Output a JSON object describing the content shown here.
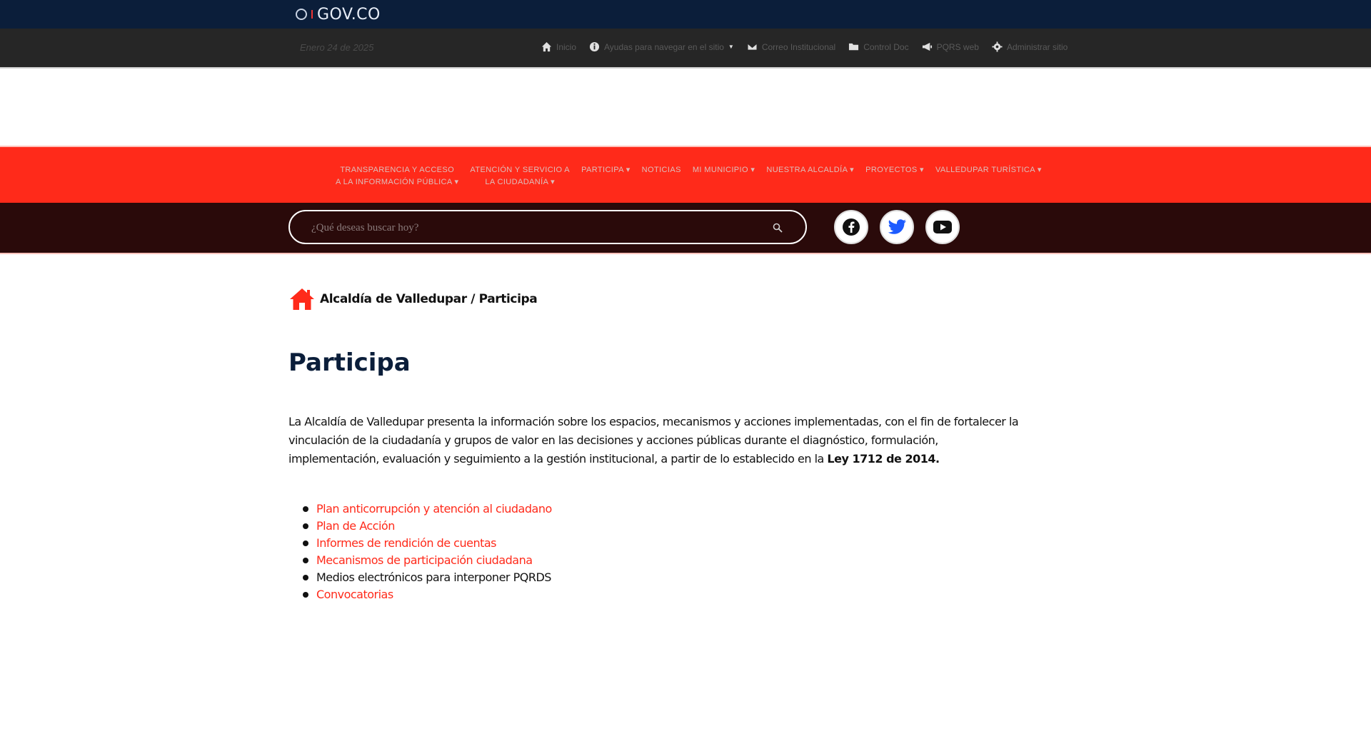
{
  "gov": {
    "logo_text": "GOV.CO"
  },
  "topbar": {
    "date": "Enero 24 de 2025",
    "items": [
      {
        "label": "Inicio",
        "icon": "home-icon"
      },
      {
        "label": "Ayudas para navegar en el sitio",
        "icon": "info-icon",
        "dropdown": true
      },
      {
        "label": "Correo Institucional",
        "icon": "mail-icon"
      },
      {
        "label": "Control Doc",
        "icon": "folder-icon"
      },
      {
        "label": "PQRS web",
        "icon": "megaphone-icon"
      },
      {
        "label": "Administrar sitio",
        "icon": "gear-icon"
      }
    ]
  },
  "mainnav": {
    "items": [
      {
        "line1": "TRANSPARENCIA Y ACCESO",
        "line2": "A LA INFORMACIÓN PÚBLICA ▾"
      },
      {
        "line1": "ATENCIÓN Y SERVICIO A",
        "line2": "LA CIUDADANÍA ▾"
      },
      {
        "line1": "PARTICIPA ▾",
        "line2": ""
      },
      {
        "line1": "NOTICIAS",
        "line2": ""
      },
      {
        "line1": "MI MUNICIPIO ▾",
        "line2": ""
      },
      {
        "line1": "NUESTRA ALCALDÍA ▾",
        "line2": ""
      },
      {
        "line1": "PROYECTOS ▾",
        "line2": ""
      },
      {
        "line1": "VALLEDUPAR TURÍSTICA ▾",
        "line2": ""
      }
    ]
  },
  "search": {
    "placeholder": "¿Qué deseas buscar hoy?"
  },
  "social": [
    {
      "name": "facebook",
      "icon": "facebook-icon"
    },
    {
      "name": "twitter",
      "icon": "twitter-icon"
    },
    {
      "name": "youtube",
      "icon": "youtube-icon"
    }
  ],
  "breadcrumb": {
    "text": "Alcaldía de Valledupar / Participa"
  },
  "page": {
    "title": "Participa",
    "intro": "La Alcaldía de Valledupar presenta la información sobre los espacios, mecanismos y acciones implementadas, con el fin de fortalecer la vinculación de la ciudadanía y grupos de valor en las decisiones y acciones públicas durante el diagnóstico, formulación, implementación, evaluación y seguimiento a la gestión institucional, a partir de lo establecido en la ",
    "intro_bold": "Ley 1712 de 2014."
  },
  "links": [
    {
      "label": "Plan anticorrupción y atención al ciudadano",
      "color": "#ff2a1a"
    },
    {
      "label": "Plan de Acción",
      "color": "#ff2a1a"
    },
    {
      "label": "Informes de rendición de cuentas",
      "color": "#ff2a1a"
    },
    {
      "label": "Mecanismos de participación ciudadana",
      "color": "#ff2a1a"
    },
    {
      "label": "Medios electrónicos para interponer PQRDS",
      "color": "#111111"
    },
    {
      "label": "Convocatorias",
      "color": "#ff2a1a"
    }
  ],
  "colors": {
    "gov_bar": "#0b1e3a",
    "topbar": "#262626",
    "accent": "#ff2a1a",
    "search_bar": "#2a0a0a"
  }
}
